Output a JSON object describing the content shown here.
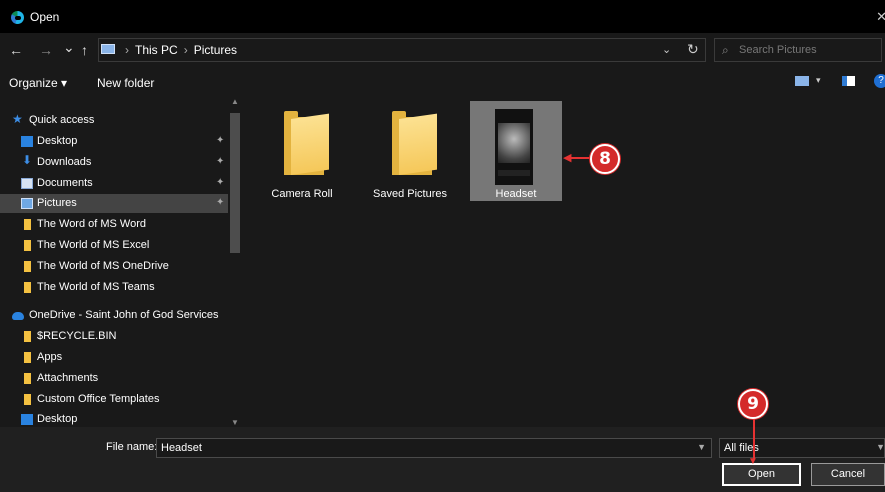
{
  "window": {
    "title": "Open",
    "close_glyph": "✕"
  },
  "nav": {
    "back": "←",
    "forward": "→",
    "recent": "⌄",
    "up": "↑",
    "dropdown": "⌄",
    "refresh": "↻"
  },
  "address": {
    "crumbs": [
      "This PC",
      "Pictures"
    ],
    "separator": "›"
  },
  "search": {
    "placeholder": "Search Pictures",
    "glyph": "⌕"
  },
  "toolbar": {
    "organize": "Organize ▾",
    "new_folder": "New folder",
    "view_dropdown": "▾",
    "help": "?"
  },
  "sidebar": {
    "quick_access": "Quick access",
    "items": [
      {
        "label": "Desktop",
        "icon": "desktop-icon",
        "pinned": true
      },
      {
        "label": "Downloads",
        "icon": "downloads-icon",
        "pinned": true
      },
      {
        "label": "Documents",
        "icon": "documents-icon",
        "pinned": true
      },
      {
        "label": "Pictures",
        "icon": "pictures-icon",
        "pinned": true,
        "selected": true
      },
      {
        "label": "The Word of MS Word",
        "icon": "folder-icon"
      },
      {
        "label": "The World of MS Excel",
        "icon": "folder-icon"
      },
      {
        "label": "The World of MS OneDrive",
        "icon": "folder-icon"
      },
      {
        "label": "The World of MS Teams",
        "icon": "folder-icon"
      }
    ],
    "onedrive": "OneDrive - Saint John of God Services",
    "onedrive_items": [
      {
        "label": "$RECYCLE.BIN",
        "icon": "folder-icon"
      },
      {
        "label": "Apps",
        "icon": "folder-icon"
      },
      {
        "label": "Attachments",
        "icon": "folder-icon"
      },
      {
        "label": "Custom Office Templates",
        "icon": "folder-icon"
      },
      {
        "label": "Desktop",
        "icon": "desktop-icon"
      }
    ],
    "pin_glyph": "📌"
  },
  "content": {
    "items": [
      {
        "label": "Camera Roll",
        "type": "folder"
      },
      {
        "label": "Saved Pictures",
        "type": "folder"
      },
      {
        "label": "Headset",
        "type": "image",
        "selected": true
      }
    ]
  },
  "callouts": {
    "eight": "8",
    "nine": "9"
  },
  "bottom": {
    "file_name_label": "File name:",
    "file_name_value": "Headset",
    "file_type": "All files",
    "open": "Open",
    "cancel": "Cancel"
  },
  "colors": {
    "accent": "#1f6fd3",
    "callout": "#d42a2a",
    "folder": "#f4c141"
  }
}
